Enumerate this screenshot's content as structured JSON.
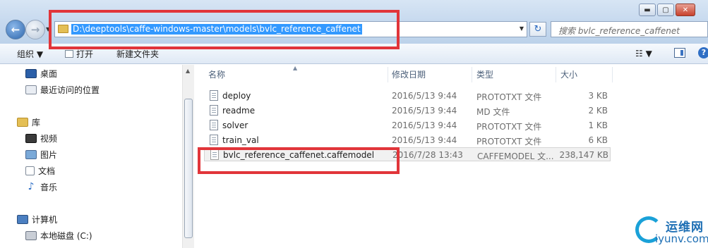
{
  "address": {
    "path": "D:\\deeptools\\caffe-windows-master\\models\\bvlc_reference_caffenet"
  },
  "search": {
    "placeholder": "搜索 bvlc_reference_caffenet"
  },
  "window_buttons": {
    "minimize": "▬",
    "maximize": "▢",
    "close": "✕"
  },
  "toolbar": {
    "organize": "组织 ▼",
    "open": "打开",
    "new_folder": "新建文件夹",
    "views": "☷ ▼",
    "help": "?"
  },
  "sidebar": {
    "items": [
      {
        "label": "桌面",
        "icon": "desktop-icon"
      },
      {
        "label": "最近访问的位置",
        "icon": "recent-places-icon"
      },
      {
        "label": "库",
        "icon": "library-icon"
      },
      {
        "label": "视频",
        "icon": "video-icon"
      },
      {
        "label": "图片",
        "icon": "picture-icon"
      },
      {
        "label": "文档",
        "icon": "document-icon"
      },
      {
        "label": "音乐",
        "icon": "music-icon"
      },
      {
        "label": "计算机",
        "icon": "computer-icon"
      },
      {
        "label": "本地磁盘 (C:)",
        "icon": "drive-icon"
      }
    ]
  },
  "columns": {
    "name": "名称",
    "date": "修改日期",
    "type": "类型",
    "size": "大小"
  },
  "files": [
    {
      "name": "deploy",
      "date": "2016/5/13 9:44",
      "type": "PROTOTXT 文件",
      "size": "3 KB"
    },
    {
      "name": "readme",
      "date": "2016/5/13 9:44",
      "type": "MD 文件",
      "size": "2 KB"
    },
    {
      "name": "solver",
      "date": "2016/5/13 9:44",
      "type": "PROTOTXT 文件",
      "size": "1 KB"
    },
    {
      "name": "train_val",
      "date": "2016/5/13 9:44",
      "type": "PROTOTXT 文件",
      "size": "6 KB"
    },
    {
      "name": "bvlc_reference_caffenet.caffemodel",
      "date": "2016/7/28 13:43",
      "type": "CAFFEMODEL 文...",
      "size": "238,147 KB"
    }
  ],
  "watermark": {
    "cn": "运维网",
    "en": "iyunv.com"
  },
  "colors": {
    "highlight": "#e1353a",
    "selection": "#3399ff",
    "toolbar": "#dfe9f5"
  }
}
